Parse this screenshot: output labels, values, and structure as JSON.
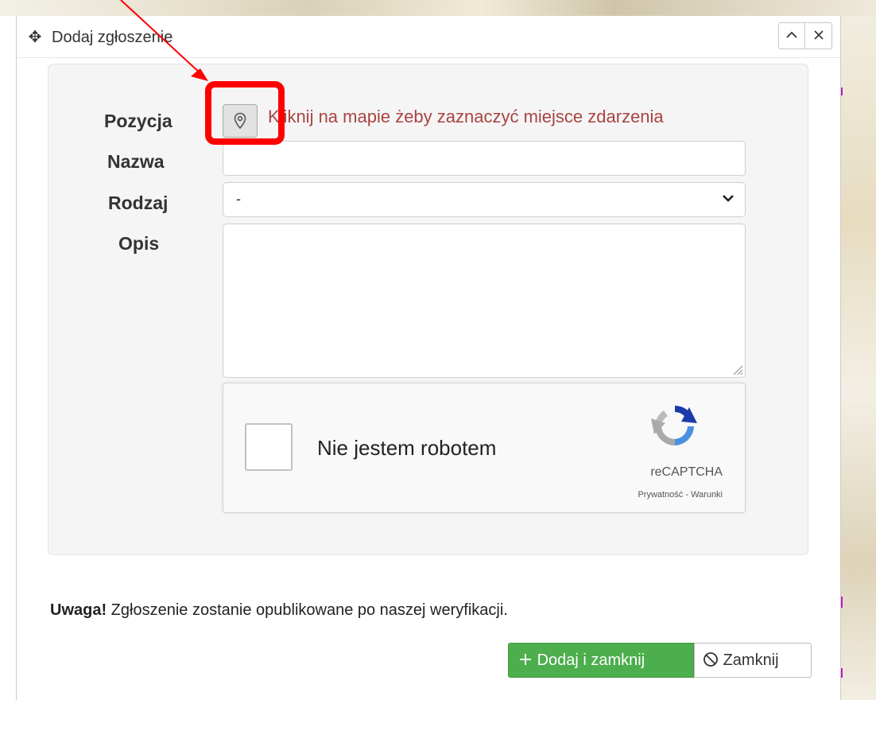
{
  "dialog": {
    "title": "Dodaj zgłoszenie",
    "move_icon": "move-arrows-icon",
    "collapse_icon": "chevron-up-icon",
    "close_icon": "close-icon"
  },
  "form": {
    "position_label": "Pozycja",
    "position_button_icon": "map-marker-icon",
    "position_hint": "Kliknij na mapie żeby zaznaczyć miejsce zdarzenia",
    "name_label": "Nazwa",
    "name_value": "",
    "type_label": "Rodzaj",
    "type_selected": "-",
    "description_label": "Opis",
    "description_value": ""
  },
  "captcha": {
    "checkbox_label": "Nie jestem robotem",
    "brand": "reCAPTCHA",
    "terms": "Prywatność - Warunki"
  },
  "notice": {
    "strong": "Uwaga!",
    "text": " Zgłoszenie zostanie opublikowane po naszej weryfikacji."
  },
  "buttons": {
    "add_icon": "plus-icon",
    "add_label": "Dodaj i zamknij",
    "close_icon": "ban-icon",
    "close_label": "Zamknij"
  },
  "colors": {
    "hint": "#a94442",
    "add_button": "#4cae4c",
    "annotation": "#ff0000"
  }
}
